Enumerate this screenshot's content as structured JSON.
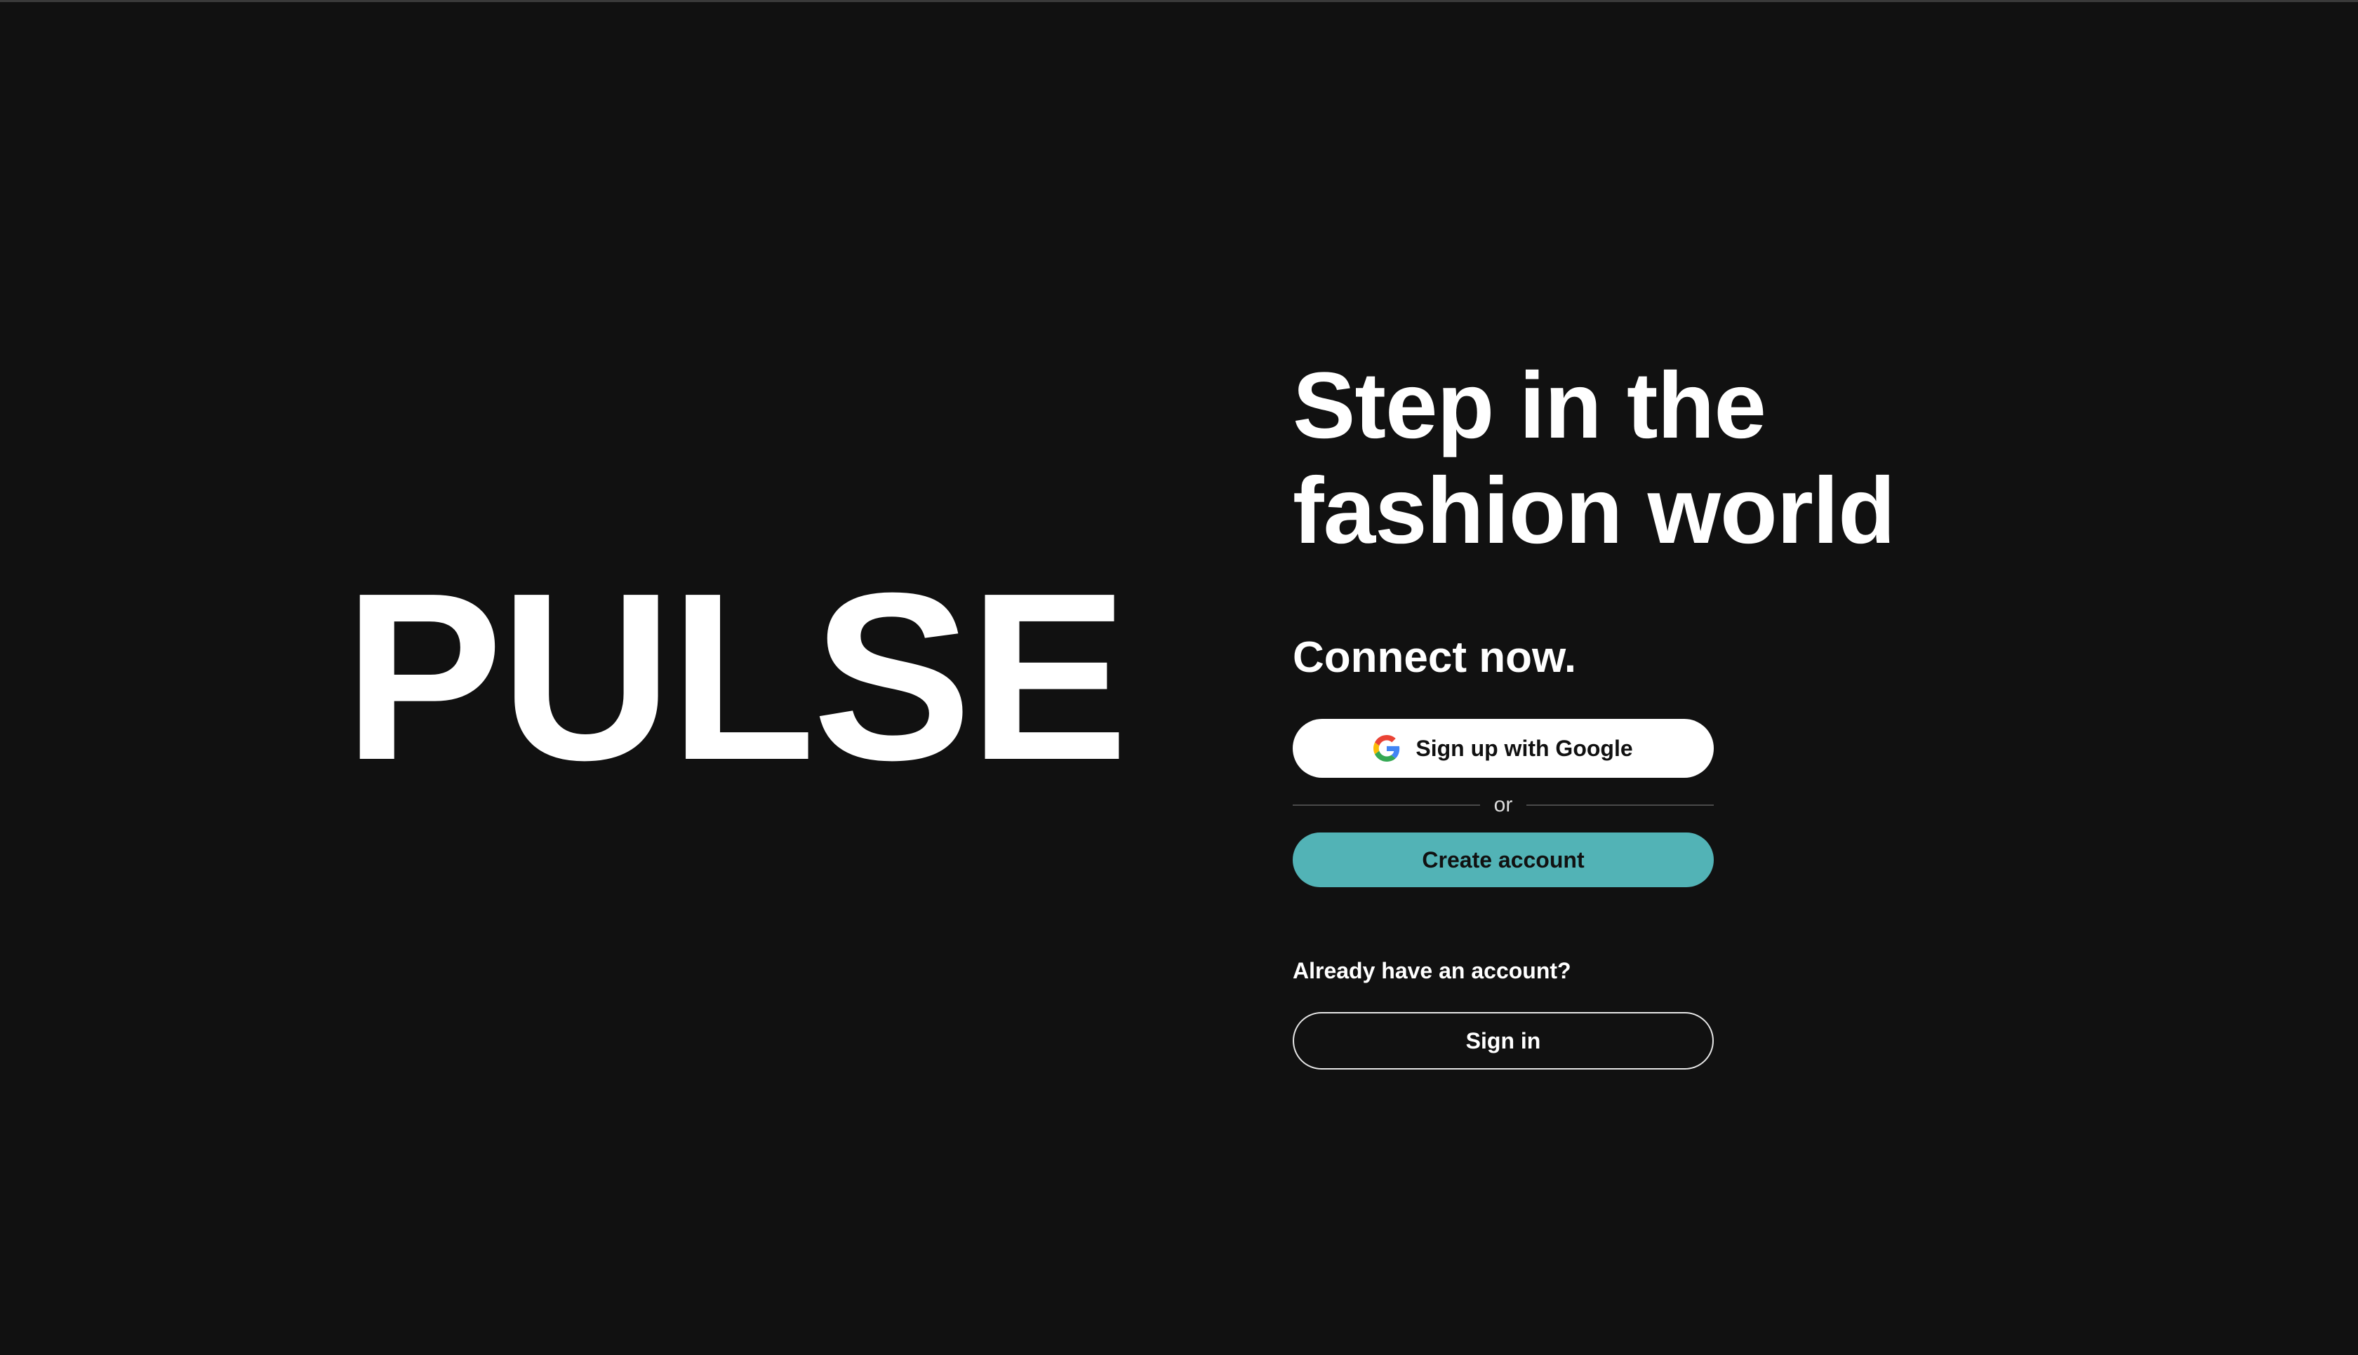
{
  "brand": {
    "logo_text": "PULSE"
  },
  "hero": {
    "headline_line1": "Step in the",
    "headline_line2": "fashion world",
    "subheadline": "Connect now."
  },
  "auth": {
    "google_button_label": "Sign up with Google",
    "google_icon": "google-g-icon",
    "divider_text": "or",
    "create_account_label": "Create account",
    "existing_account_prompt": "Already have an account?",
    "sign_in_label": "Sign in"
  },
  "colors": {
    "background": "#111111",
    "accent": "#52b3b6",
    "text": "#ffffff"
  }
}
